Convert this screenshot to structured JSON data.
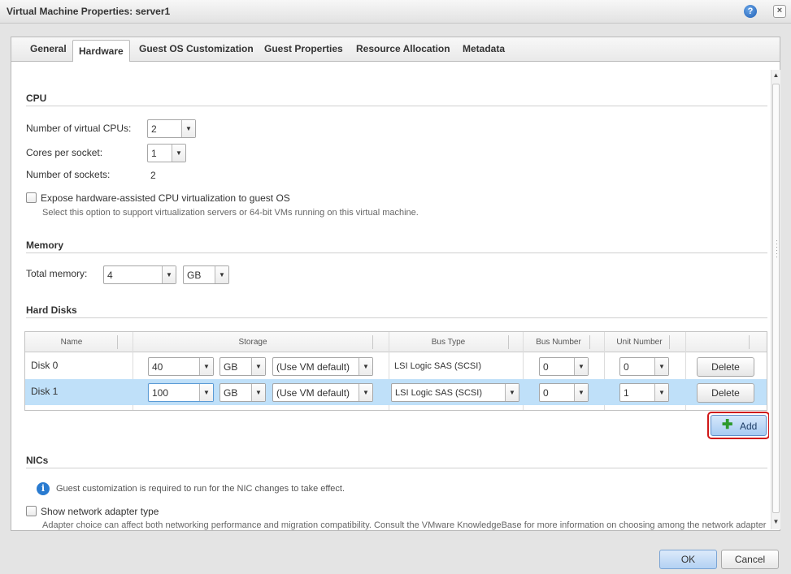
{
  "window": {
    "title": "Virtual Machine Properties: server1",
    "help_icon": "?",
    "close_icon": "×"
  },
  "tabs": [
    "General",
    "Hardware",
    "Guest OS Customization",
    "Guest Properties",
    "Resource Allocation",
    "Metadata"
  ],
  "cpu": {
    "title": "CPU",
    "num_vcpus_label": "Number of virtual CPUs:",
    "num_vcpus_value": "2",
    "cores_label": "Cores per socket:",
    "cores_value": "1",
    "sockets_label": "Number of sockets:",
    "sockets_value": "2",
    "expose_label": "Expose hardware-assisted CPU virtualization to guest OS",
    "expose_hint": "Select this option to support virtualization servers or 64-bit VMs running on this virtual machine."
  },
  "memory": {
    "title": "Memory",
    "total_label": "Total memory:",
    "total_value": "4",
    "unit": "GB"
  },
  "hard_disks": {
    "title": "Hard Disks",
    "columns": {
      "name": "Name",
      "storage": "Storage",
      "bus_type": "Bus Type",
      "bus_number": "Bus Number",
      "unit_number": "Unit Number"
    },
    "rows": [
      {
        "name": "Disk 0",
        "size": "40",
        "unit": "GB",
        "storage_policy": "(Use VM default)",
        "bus_type": "LSI Logic SAS (SCSI)",
        "bus_number": "0",
        "unit_number": "0",
        "delete_label": "Delete"
      },
      {
        "name": "Disk 1",
        "size": "100",
        "unit": "GB",
        "storage_policy": "(Use VM default)",
        "bus_type": "LSI Logic SAS (SCSI)",
        "bus_number": "0",
        "unit_number": "1",
        "delete_label": "Delete"
      }
    ],
    "add_label": "Add"
  },
  "nics": {
    "title": "NICs",
    "info_icon": "i",
    "info_text": "Guest customization is required to run for the NIC changes to take effect.",
    "show_type_label": "Show network adapter type",
    "adapter_hint": "Adapter choice can affect both networking performance and migration compatibility. Consult the VMware KnowledgeBase for more information on choosing among the network adapter"
  },
  "icons": {
    "dropdown": "▼",
    "scroll_up": "▲",
    "scroll_down": "▼",
    "add": "✚"
  },
  "footer": {
    "ok_label": "OK",
    "cancel_label": "Cancel"
  }
}
